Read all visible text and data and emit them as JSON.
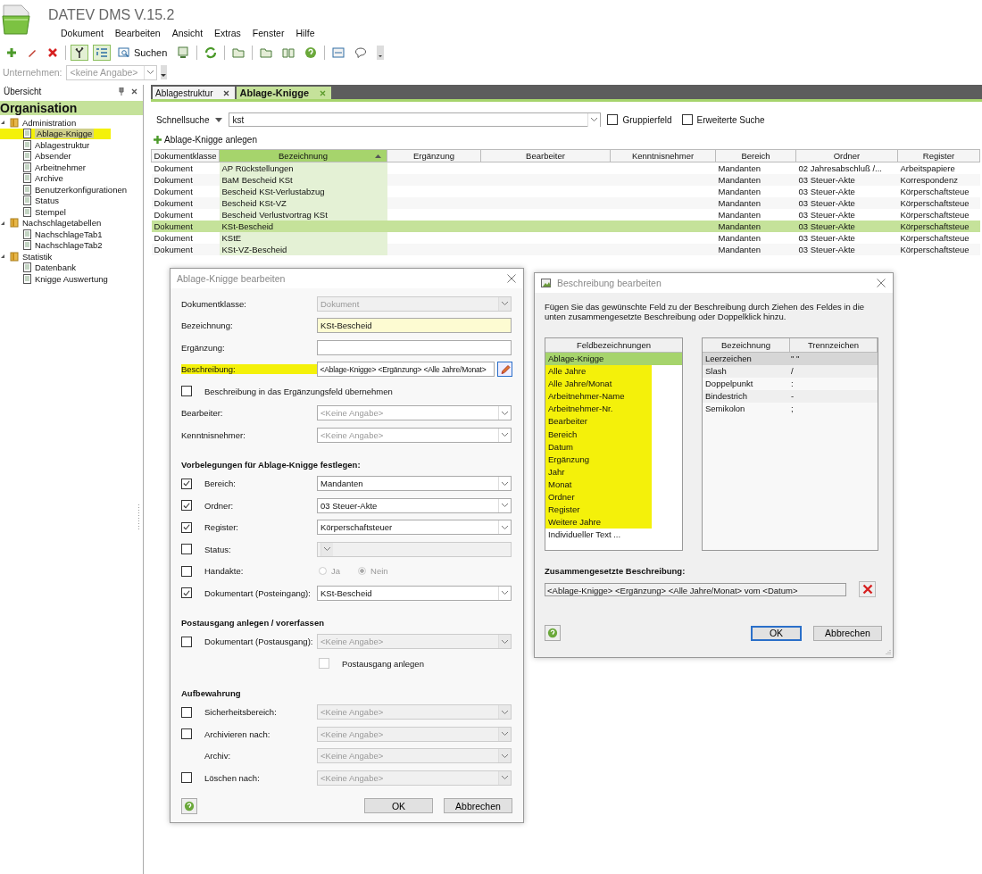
{
  "app": {
    "title": "DATEV DMS V.15.2",
    "menu": [
      "Dokument",
      "Bearbeiten",
      "Ansicht",
      "Extras",
      "Fenster",
      "Hilfe"
    ]
  },
  "toolbar": [
    {
      "kind": "plus",
      "pressed": false
    },
    {
      "kind": "pencil",
      "pressed": false
    },
    {
      "kind": "cross",
      "pressed": false
    },
    {
      "kind": "separator"
    },
    {
      "kind": "tree",
      "pressed": true
    },
    {
      "kind": "list",
      "pressed": true
    },
    {
      "kind": "search",
      "label": "Suchen",
      "pressed": false
    },
    {
      "kind": "monitor",
      "pressed": false
    },
    {
      "kind": "separator"
    },
    {
      "kind": "refresh",
      "pressed": false
    },
    {
      "kind": "separator"
    },
    {
      "kind": "folder",
      "pressed": false
    },
    {
      "kind": "separator"
    },
    {
      "kind": "folder",
      "pressed": false
    },
    {
      "kind": "book",
      "pressed": false
    },
    {
      "kind": "help",
      "pressed": false
    },
    {
      "kind": "separator"
    },
    {
      "kind": "card",
      "pressed": false
    },
    {
      "kind": "chat",
      "pressed": false
    },
    {
      "kind": "overflow",
      "pressed": false
    }
  ],
  "company": {
    "label": "Unternehmen:",
    "placeholder": "<keine Angabe>"
  },
  "sidebar": {
    "title": "Übersicht",
    "root": "Organisation",
    "tree": [
      {
        "label": "Administration",
        "kind": "folder",
        "expanded": true,
        "selected": false,
        "children": [
          {
            "label": "Ablage-Knigge",
            "kind": "document",
            "selected": true
          },
          {
            "label": "Ablagestruktur",
            "kind": "document",
            "selected": false
          },
          {
            "label": "Absender",
            "kind": "document",
            "selected": false
          },
          {
            "label": "Arbeitnehmer",
            "kind": "document",
            "selected": false
          },
          {
            "label": "Archive",
            "kind": "document",
            "selected": false
          },
          {
            "label": "Benutzerkonfigurationen",
            "kind": "document",
            "selected": false
          },
          {
            "label": "Status",
            "kind": "document",
            "selected": false
          },
          {
            "label": "Stempel",
            "kind": "document",
            "selected": false
          }
        ]
      },
      {
        "label": "Nachschlagetabellen",
        "kind": "folder",
        "expanded": true,
        "selected": false,
        "children": [
          {
            "label": "NachschlageTab1",
            "kind": "document",
            "selected": false
          },
          {
            "label": "NachschlageTab2",
            "kind": "document",
            "selected": false
          }
        ]
      },
      {
        "label": "Statistik",
        "kind": "folder",
        "expanded": true,
        "selected": false,
        "children": [
          {
            "label": "Datenbank",
            "kind": "document",
            "selected": false
          },
          {
            "label": "Knigge Auswertung",
            "kind": "document",
            "selected": false
          }
        ]
      }
    ]
  },
  "tabs": [
    {
      "label": "Ablagestruktur",
      "selected": false
    },
    {
      "label": "Ablage-Knigge",
      "selected": true
    }
  ],
  "search": {
    "label": "Schnellsuche",
    "value": "kst",
    "options": [
      {
        "label": "Gruppierfeld",
        "checked": false
      },
      {
        "label": "Erweiterte Suche",
        "checked": false
      }
    ]
  },
  "create_link": "Ablage-Knigge anlegen",
  "table": {
    "columns": [
      {
        "label": "Dokumentklasse",
        "sorted": false
      },
      {
        "label": "Bezeichnung",
        "sorted": true
      },
      {
        "label": "Ergänzung",
        "sorted": false
      },
      {
        "label": "Bearbeiter",
        "sorted": false
      },
      {
        "label": "Kenntnisnehmer",
        "sorted": false
      },
      {
        "label": "Bereich",
        "sorted": false
      },
      {
        "label": "Ordner",
        "sorted": false
      },
      {
        "label": "Register",
        "sorted": false
      }
    ],
    "rows": [
      {
        "selected": false,
        "cells": [
          "Dokument",
          "AP Rückstellungen",
          "",
          "",
          "",
          "Mandanten",
          "02 Jahresabschluß /...",
          "Arbeitspapiere"
        ]
      },
      {
        "selected": false,
        "cells": [
          "Dokument",
          "BaM Bescheid KSt",
          "",
          "",
          "",
          "Mandanten",
          "03 Steuer-Akte",
          "Korrespondenz"
        ]
      },
      {
        "selected": false,
        "cells": [
          "Dokument",
          "Bescheid KSt-Verlustabzug",
          "",
          "",
          "",
          "Mandanten",
          "03 Steuer-Akte",
          "Körperschaftsteue"
        ]
      },
      {
        "selected": false,
        "cells": [
          "Dokument",
          "Bescheid KSt-VZ",
          "",
          "",
          "",
          "Mandanten",
          "03 Steuer-Akte",
          "Körperschaftsteue"
        ]
      },
      {
        "selected": false,
        "cells": [
          "Dokument",
          "Bescheid Verlustvortrag KSt",
          "",
          "",
          "",
          "Mandanten",
          "03 Steuer-Akte",
          "Körperschaftsteue"
        ]
      },
      {
        "selected": true,
        "cells": [
          "Dokument",
          "KSt-Bescheid",
          "",
          "",
          "",
          "Mandanten",
          "03 Steuer-Akte",
          "Körperschaftsteue"
        ]
      },
      {
        "selected": false,
        "cells": [
          "Dokument",
          "KStE",
          "",
          "",
          "",
          "Mandanten",
          "03 Steuer-Akte",
          "Körperschaftsteue"
        ]
      },
      {
        "selected": false,
        "cells": [
          "Dokument",
          "KSt-VZ-Bescheid",
          "",
          "",
          "",
          "Mandanten",
          "03 Steuer-Akte",
          "Körperschaftsteue"
        ]
      }
    ]
  },
  "edit_dialog": {
    "title": "Ablage-Knigge bearbeiten",
    "rows": [
      {
        "kind": "field",
        "label": "Dokumentklasse:",
        "value": "Dokument",
        "dropdown": true,
        "disabled": true,
        "required": false,
        "highlighted": false
      },
      {
        "kind": "field",
        "label": "Bezeichnung:",
        "value": "KSt-Bescheid",
        "disabled": false,
        "required": true,
        "highlighted": false
      },
      {
        "kind": "field",
        "label": "Ergänzung:",
        "disabled": false,
        "required": false,
        "highlighted": false
      },
      {
        "kind": "field",
        "label": "Beschreibung:",
        "value": "<Ablage-Knigge> <Ergänzung> <Alle Jahre/Monat>",
        "disabled": false,
        "required": false,
        "highlighted": true,
        "edit_button": true
      },
      {
        "kind": "checkbox",
        "label": "Beschreibung in das Ergänzungsfeld übernehmen",
        "checked": false
      },
      {
        "kind": "field",
        "label": "Bearbeiter:",
        "placeholder": "<Keine Angabe>",
        "dropdown": true,
        "disabled": false,
        "required": false,
        "highlighted": false
      },
      {
        "kind": "field",
        "label": "Kenntnisnehmer:",
        "placeholder": "<Keine Angabe>",
        "dropdown": true,
        "disabled": false,
        "required": false,
        "highlighted": false
      },
      {
        "kind": "heading",
        "label": "Vorbelegungen für Ablage-Knigge festlegen:"
      },
      {
        "kind": "check-field",
        "label": "Bereich:",
        "checked": true,
        "value": "Mandanten",
        "disabled": false
      },
      {
        "kind": "check-field",
        "label": "Ordner:",
        "checked": true,
        "value": "03 Steuer-Akte",
        "disabled": false
      },
      {
        "kind": "check-field",
        "label": "Register:",
        "checked": true,
        "value": "Körperschaftsteuer",
        "disabled": false
      },
      {
        "kind": "check-field",
        "label": "Status:",
        "checked": false,
        "disabled": true
      },
      {
        "kind": "check-radio",
        "label": "Handakte:",
        "checked": false,
        "options": [
          {
            "label": "Ja",
            "selected": false
          },
          {
            "label": "Nein",
            "selected": true
          }
        ]
      },
      {
        "kind": "check-field",
        "label": "Dokumentart (Posteingang):",
        "checked": true,
        "value": "KSt-Bescheid",
        "disabled": false
      },
      {
        "kind": "heading",
        "label": "Postausgang anlegen / vorerfassen"
      },
      {
        "kind": "check-field",
        "label": "Dokumentart (Postausgang):",
        "checked": false,
        "placeholder": "<Keine Angabe>",
        "disabled": true
      },
      {
        "kind": "sub-checkbox",
        "label": "Postausgang anlegen",
        "checked": false,
        "disabled": true
      },
      {
        "kind": "heading",
        "label": "Aufbewahrung"
      },
      {
        "kind": "check-field",
        "label": "Sicherheitsbereich:",
        "checked": false,
        "placeholder": "<Keine Angabe>",
        "disabled": true
      },
      {
        "kind": "check-field",
        "label": "Archivieren nach:",
        "checked": false,
        "placeholder": "<Keine Angabe>",
        "disabled": true
      },
      {
        "kind": "indented-field",
        "label": "Archiv:",
        "placeholder": "<Keine Angabe>",
        "disabled": true
      },
      {
        "kind": "check-field",
        "label": "Löschen nach:",
        "checked": false,
        "placeholder": "<Keine Angabe>",
        "disabled": true
      }
    ],
    "buttons": [
      "OK",
      "Abbrechen"
    ]
  },
  "description_dialog": {
    "title": "Beschreibung bearbeiten",
    "instruction": "Fügen Sie das gewünschte Feld zu der Beschreibung durch Ziehen des Feldes in die unten zusammengesetzte Beschreibung oder Doppelklick hinzu.",
    "fields_header": "Feldbezeichnungen",
    "fields": [
      {
        "label": "Ablage-Knigge",
        "selected": true,
        "highlighted": true
      },
      {
        "label": "Alle Jahre",
        "selected": false,
        "highlighted": true
      },
      {
        "label": "Alle Jahre/Monat",
        "selected": false,
        "highlighted": true
      },
      {
        "label": "Arbeitnehmer-Name",
        "selected": false,
        "highlighted": true
      },
      {
        "label": "Arbeitnehmer-Nr.",
        "selected": false,
        "highlighted": true
      },
      {
        "label": "Bearbeiter",
        "selected": false,
        "highlighted": true
      },
      {
        "label": "Bereich",
        "selected": false,
        "highlighted": true
      },
      {
        "label": "Datum",
        "selected": false,
        "highlighted": true
      },
      {
        "label": "Ergänzung",
        "selected": false,
        "highlighted": true
      },
      {
        "label": "Jahr",
        "selected": false,
        "highlighted": true
      },
      {
        "label": "Monat",
        "selected": false,
        "highlighted": true
      },
      {
        "label": "Ordner",
        "selected": false,
        "highlighted": true
      },
      {
        "label": "Register",
        "selected": false,
        "highlighted": true
      },
      {
        "label": "Weitere Jahre",
        "selected": false,
        "highlighted": true
      },
      {
        "label": "Individueller Text ...",
        "selected": false,
        "highlighted": false
      }
    ],
    "separator_columns": [
      "Bezeichnung",
      "Trennzeichen"
    ],
    "separators": [
      {
        "name": "Leerzeichen",
        "char": "\" \"",
        "selected": true
      },
      {
        "name": "Slash",
        "char": "/",
        "selected": false
      },
      {
        "name": "Doppelpunkt",
        "char": ":",
        "selected": false
      },
      {
        "name": "Bindestrich",
        "char": "-",
        "selected": false
      },
      {
        "name": "Semikolon",
        "char": ";",
        "selected": false
      }
    ],
    "result_label": "Zusammengesetzte Beschreibung:",
    "result": "<Ablage-Knigge> <Ergänzung> <Alle Jahre/Monat> vom <Datum>",
    "buttons": [
      {
        "label": "OK",
        "default": true
      },
      {
        "label": "Abbrechen",
        "default": false
      }
    ]
  }
}
